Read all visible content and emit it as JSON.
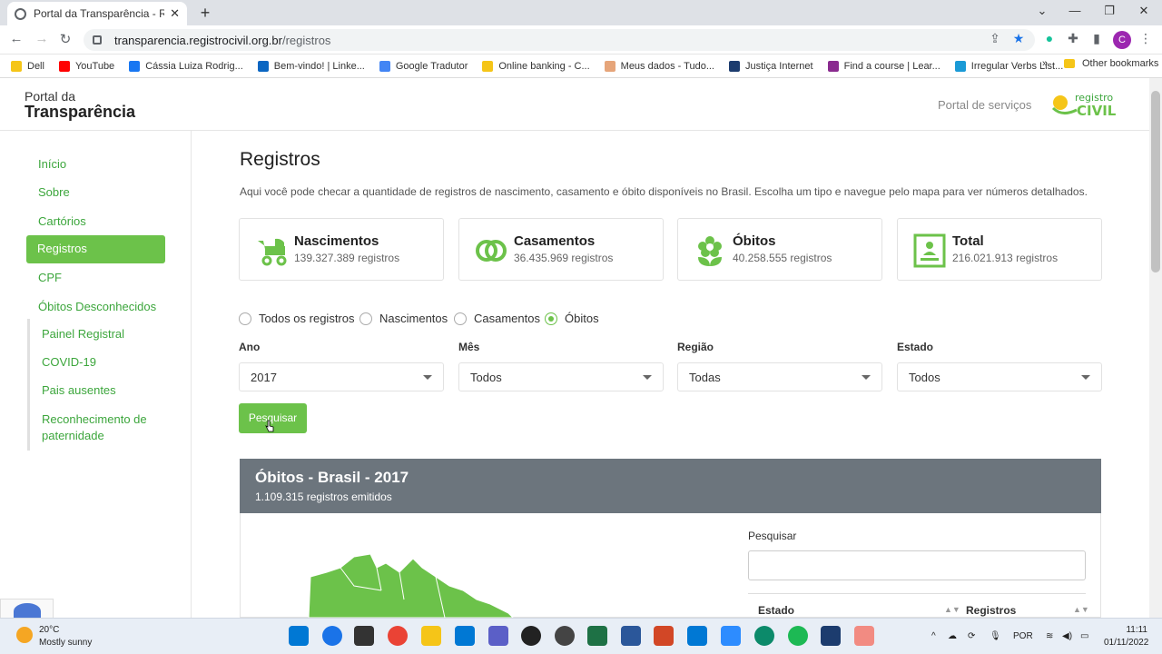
{
  "browser": {
    "tab_title": "Portal da Transparência - Registro",
    "tab_close": "✕",
    "new_tab": "+",
    "url_domain": "transparencia.registrocivil.org.br",
    "url_path": "/registros",
    "avatar_letter": "C",
    "bookmarks": [
      {
        "label": "Dell",
        "color": "#f5c518"
      },
      {
        "label": "YouTube",
        "color": "#ff0000"
      },
      {
        "label": "Cássia Luiza Rodrig...",
        "color": "#1877f2"
      },
      {
        "label": "Bem-vindo! | Linke...",
        "color": "#0a66c2"
      },
      {
        "label": "Google Tradutor",
        "color": "#4285f4"
      },
      {
        "label": "Online banking - C...",
        "color": "#f5c518"
      },
      {
        "label": "Meus dados - Tudo...",
        "color": "#e6a57a"
      },
      {
        "label": "Justiça Internet",
        "color": "#1c3c6e"
      },
      {
        "label": "Find a course | Lear...",
        "color": "#8a2b8f"
      },
      {
        "label": "Irregular Verbs List...",
        "color": "#1a9ad6"
      }
    ],
    "bookmarks_more": "»",
    "other_bookmarks": "Other bookmarks"
  },
  "header": {
    "brand_line1": "Portal da",
    "brand_line2": "Transparência",
    "services_link": "Portal de serviços",
    "logo_text_top": "registro",
    "logo_text_bottom": "CIVIL"
  },
  "sidebar": {
    "items": [
      "Início",
      "Sobre",
      "Cartórios",
      "Registros",
      "CPF",
      "Óbitos Desconhecidos"
    ],
    "subitems": [
      "Painel Registral",
      "COVID-19",
      "Pais ausentes",
      "Reconhecimento de paternidade"
    ]
  },
  "main": {
    "title": "Registros",
    "description": "Aqui você pode checar a quantidade de registros de nascimento, casamento e óbito disponíveis no Brasil. Escolha um tipo e navegue pelo mapa para ver números detalhados.",
    "cards": [
      {
        "label": "Nascimentos",
        "value": "139.327.389 registros"
      },
      {
        "label": "Casamentos",
        "value": "36.435.969 registros"
      },
      {
        "label": "Óbitos",
        "value": "40.258.555 registros"
      },
      {
        "label": "Total",
        "value": "216.021.913 registros"
      }
    ],
    "filters": {
      "radio_options": [
        "Todos os registros",
        "Nascimentos",
        "Casamentos",
        "Óbitos"
      ],
      "selected": "Óbitos",
      "fields": [
        {
          "label": "Ano",
          "value": "2017"
        },
        {
          "label": "Mês",
          "value": "Todos"
        },
        {
          "label": "Região",
          "value": "Todas"
        },
        {
          "label": "Estado",
          "value": "Todos"
        }
      ],
      "search_button": "Pesquisar"
    },
    "results": {
      "title": "Óbitos - Brasil - 2017",
      "subtitle": "1.109.315 registros emitidos",
      "search_label": "Pesquisar",
      "search_placeholder": "",
      "columns": [
        "Estado",
        "Registros"
      ]
    }
  },
  "taskbar": {
    "temperature": "20°C",
    "weather": "Mostly sunny",
    "language": "POR",
    "time": "11:11",
    "date": "01/11/2022"
  },
  "colors": {
    "accent": "#6cc24a",
    "link": "#3ca63c",
    "panel_header": "#6c757d"
  }
}
